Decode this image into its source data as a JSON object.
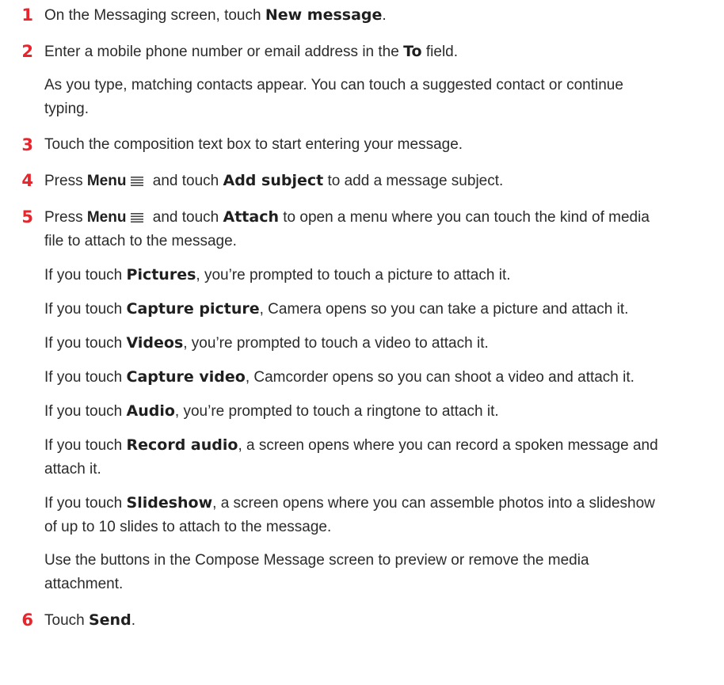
{
  "steps": [
    {
      "number": "1",
      "t1": "On the Messaging screen, touch ",
      "b1": "New message",
      "t2": "."
    },
    {
      "number": "2",
      "t1": "Enter a mobile phone number or email address in the ",
      "b1": "To",
      "t2": " field.",
      "note": "As you type, matching contacts appear. You can touch a suggested contact or continue typing."
    },
    {
      "number": "3",
      "text": "Touch the composition text box to start entering your message."
    },
    {
      "number": "4",
      "t1": "Press ",
      "b1": "Menu",
      "t2": " and touch ",
      "b2": "Add subject",
      "t3": " to add a message subject."
    },
    {
      "number": "5",
      "t1": "Press ",
      "b1": "Menu",
      "t2": " and touch ",
      "b2": "Attach",
      "t3": " to open a menu where you can touch the kind of media file to attach to the message.",
      "options": [
        {
          "prefix": "If you touch ",
          "bold": "Pictures",
          "rest": ", you’re prompted to touch a picture to attach it."
        },
        {
          "prefix": "If you touch ",
          "bold": "Capture picture",
          "rest": ", Camera opens so you can take a picture and attach it."
        },
        {
          "prefix": "If you touch ",
          "bold": "Videos",
          "rest": ", you’re prompted to touch a video to attach it."
        },
        {
          "prefix": "If you touch ",
          "bold": "Capture video",
          "rest": ", Camcorder opens so you can shoot a video and attach it."
        },
        {
          "prefix": "If you touch ",
          "bold": "Audio",
          "rest": ", you’re prompted to touch a ringtone to attach it."
        },
        {
          "prefix": "If you touch ",
          "bold": "Record audio",
          "rest": ", a screen opens where you can record a spoken message and attach it."
        },
        {
          "prefix": "If you touch ",
          "bold": "Slideshow",
          "rest": ", a screen opens where you can assemble photos into a slideshow of up to 10 slides to attach to the message."
        }
      ],
      "closing": "Use the buttons in the Compose Message screen to preview or remove the media attachment."
    },
    {
      "number": "6",
      "t1": "Touch ",
      "b1": "Send",
      "t2": "."
    }
  ],
  "icons": {
    "menu": "menu-icon"
  },
  "colors": {
    "step_number": "#e8242c",
    "text": "#2b2b2b"
  }
}
